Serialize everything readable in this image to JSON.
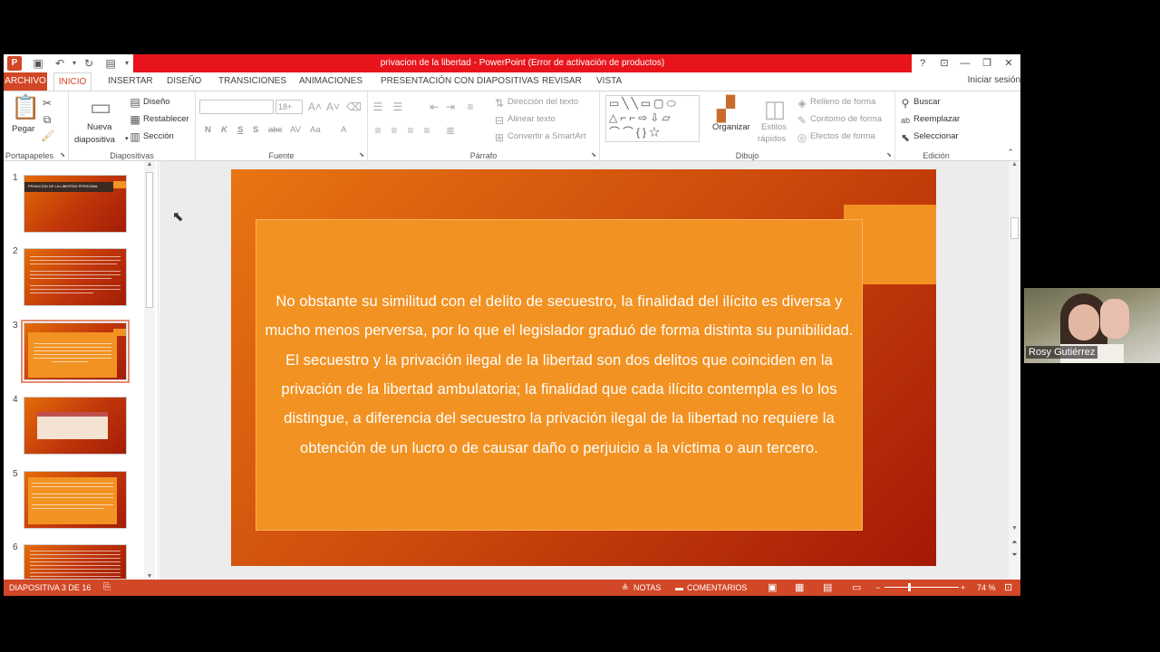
{
  "window": {
    "title": "privacion de la libertad - PowerPoint (Error de activación de productos)",
    "controls": [
      "?",
      "⊡",
      "—",
      "❐",
      "✕"
    ]
  },
  "tabs": [
    "ARCHIVO",
    "INICIO",
    "INSERTAR",
    "DISEÑO",
    "TRANSICIONES",
    "ANIMACIONES",
    "PRESENTACIÓN CON DIAPOSITIVAS",
    "REVISAR",
    "VISTA"
  ],
  "account": "Iniciar sesión",
  "ribbon": {
    "portapapeles": {
      "label": "Portapapeles",
      "paste": "Pegar"
    },
    "diapositivas": {
      "label": "Diapositivas",
      "new_slide_1": "Nueva",
      "new_slide_2": "diapositiva",
      "layout": "Diseño",
      "reset": "Restablecer",
      "section": "Sección"
    },
    "fuente": {
      "label": "Fuente",
      "size": "18+",
      "bold": "N",
      "italic": "K",
      "underline": "S",
      "strike": "S",
      "spacing": "AV",
      "case": "Aa",
      "color": "A"
    },
    "parrafo": {
      "label": "Párrafo",
      "text_direction": "Dirección del texto",
      "align_text": "Alinear texto",
      "smartart": "Convertir a SmartArt"
    },
    "dibujo": {
      "label": "Dibujo",
      "arrange": "Organizar",
      "styles_1": "Estilos",
      "styles_2": "rápidos",
      "fill": "Relleno de forma",
      "outline": "Contorno de forma",
      "effects": "Efectos de forma"
    },
    "edicion": {
      "label": "Edición",
      "find": "Buscar",
      "replace": "Reemplazar",
      "select": "Seleccionar"
    }
  },
  "thumbnails": [
    {
      "num": "1",
      "text": "PRIVACION DE LA LIBERTAD PERSONAL"
    },
    {
      "num": "2",
      "text": ""
    },
    {
      "num": "3",
      "text": ""
    },
    {
      "num": "4",
      "text": ""
    },
    {
      "num": "5",
      "text": ""
    },
    {
      "num": "6",
      "text": ""
    }
  ],
  "slide": {
    "body": "No obstante su similitud con el delito de secuestro, la finalidad del ilícito es diversa y mucho menos perversa, por lo que el legislador graduó de forma distinta su punibilidad. El secuestro y la privación ilegal de la libertad son dos delitos que coinciden en la privación de la libertad ambulatoria; la finalidad que cada ilícito contempla es lo los distingue,  a diferencia del secuestro la privación ilegal de la libertad no requiere la obtención de un lucro o de causar daño o perjuicio a la víctima o aun tercero."
  },
  "status": {
    "slide_info": "DIAPOSITIVA 3 DE 16",
    "notes": "NOTAS",
    "comments": "COMENTARIOS",
    "zoom": "74 %"
  },
  "webcam": {
    "name": "Rosy Gutiérrez"
  },
  "colors": {
    "accent": "#d24726",
    "title_bar": "#e8141c",
    "slide_orange": "#f29222"
  }
}
